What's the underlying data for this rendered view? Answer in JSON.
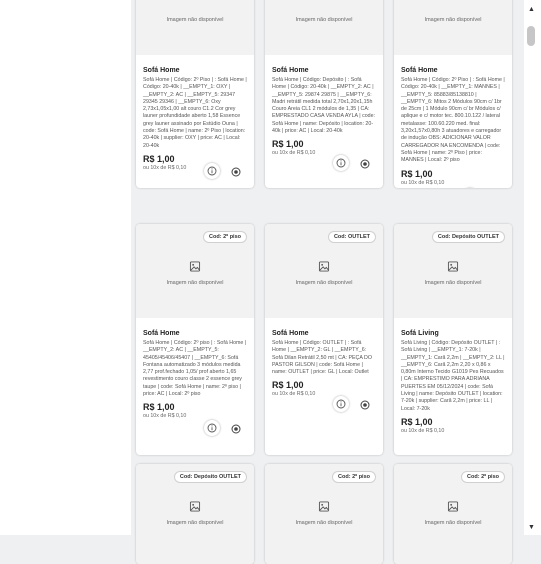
{
  "no_image_text": "Imagem não disponível",
  "cards": [
    {
      "title": "Sofá Home",
      "desc": "Sofá Home | Código: 2º Piso | : Sofá Home | Código: 20-40k | __EMPTY_1: OXY | __EMPTY_2: AC | __EMPTY_5: 29347 29345 29346 | __EMPTY_6: Oxy 2,73x1,05x1,00 alt couro C1.2 Cor grey launer profundidade aberto 1,58 Essence grey launer assinado por Estúdio Ouna | code: Sofá Home | name: 2º Piso | location: 20-40k | supplier: OXY | price: AC | Local: 20-40k",
      "price": "R$ 1,00",
      "installments": "ou 10x de R$ 0,10",
      "badge": ""
    },
    {
      "title": "Sofá Home",
      "desc": "Sofá Home | Código: Depósito | : Sofá Home | Código: 20-40k | __EMPTY_2: AC | __EMPTY_5: 29874 29875 | __EMPTY_6: Madri retrátil medida total 2,70x1,20x1,15h Couro Areia CL1 2 módulos de 1,35 | CA: EMPRESTADO CASA VENDA AYLA | code: Sofá Home | name: Depósito | location: 20-40k | price: AC | Local: 20-40k",
      "price": "R$ 1,00",
      "installments": "ou 10x de R$ 0,10",
      "badge": ""
    },
    {
      "title": "Sofá Home",
      "desc": "Sofá Home | Código: 2º Piso | : Sofá Home | Código: 20-40k | __EMPTY_1: MANNES | __EMPTY_5: 85883/85138810 | __EMPTY_6: Mitos 2 Módulos 90cm c/ 1br de 25cm | 1 Módulo 90cm c/ br Módulos c/ aplique e c/ motor tec. 800.10.122 / lateral metalasse: 100.60.220 med. final: 3,20x1,57x0,80h 3 atuadores e carregador de indução OBS: ADICIONAR VALOR CARREGADOR NA ENCOMENDA | code: Sofá Home | name: 2º Piso | price: MANNES | Local: 2º piso",
      "price": "R$ 1,00",
      "installments": "ou 10x de R$ 0,10",
      "badge": ""
    },
    {
      "title": "Sofá Home",
      "desc": "Sofá Home | Código: 2º piso | : Sofá Home | __EMPTY_2: AC | __EMPTY_5: 45405/45406/45407 | __EMPTY_6: Sofá Fontana automatizado 3 módulos medida 2,77 prof.fechado 1,05/ prof aberto 1,65 revestimento couro classe 2 essence grey taupe | code: Sofá Home | name: 2º piso | price: AC | Local: 2º piso",
      "price": "R$ 1,00",
      "installments": "ou 10x de R$ 0,10",
      "badge": "Cod: 2º piso"
    },
    {
      "title": "Sofá Home",
      "desc": "Sofá Home | Código: OUTLET | : Sofá Home | __EMPTY_2: GL | __EMPTY_6: Sofá Dilan Retrátil 2,50 mt | CA: PEÇA DO PASTOR GILSON | code: Sofá Home | name: OUTLET | price: GL | Local: Outlet",
      "price": "R$ 1,00",
      "installments": "ou 10x de R$ 0,10",
      "badge": "Cod: OUTLET"
    },
    {
      "title": "Sofá Living",
      "desc": "Sofá Living | Código: Depósito OUTLET | : Sofá Living | __EMPTY_1: 7-20k | __EMPTY_1: Carã 2,2m | __EMPTY_2: LL | __EMPTY_6: Carã 2,2m 2,20 x 0,86 x 0,80m Interno Tecido G1019 Pes Recuados | CA: EMPRESTIMO PARA ADRIANA PUERTES EM 05/12/2024 | code: Sofá Living | name: Depósito OUTLET | location: 7-20k | supplier: Carã 2,2m | price: LL | Local: 7-20k",
      "price": "R$ 1,00",
      "installments": "ou 10x de R$ 0,10",
      "badge": "Cod: Depósito OUTLET"
    },
    {
      "title": "",
      "desc": "",
      "price": "",
      "installments": "",
      "badge": "Cod: Depósito OUTLET"
    },
    {
      "title": "",
      "desc": "",
      "price": "",
      "installments": "",
      "badge": ""
    },
    {
      "title": "",
      "desc": "",
      "price": "",
      "installments": "",
      "badge": "Cod: 2º piso"
    },
    {
      "title": "",
      "desc": "",
      "price": "",
      "installments": "",
      "badge": "Cod: 2º piso"
    }
  ],
  "icons": {
    "image": "image-placeholder-icon",
    "info": "info-icon",
    "target": "target-icon"
  }
}
